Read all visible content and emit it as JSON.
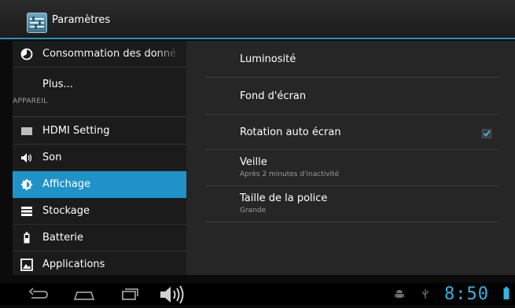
{
  "titlebar": {
    "title": "Paramètres"
  },
  "sidebar": {
    "items": [
      {
        "label": "Consommation des donné",
        "icon": "data-usage-icon"
      },
      {
        "label": "Plus..."
      },
      {
        "label": "HDMI Setting",
        "icon": "hdmi-icon"
      },
      {
        "label": "Son",
        "icon": "volume-icon"
      },
      {
        "label": "Affichage",
        "icon": "display-icon",
        "selected": true
      },
      {
        "label": "Stockage",
        "icon": "storage-icon"
      },
      {
        "label": "Batterie",
        "icon": "battery-icon"
      },
      {
        "label": "Applications",
        "icon": "applications-icon"
      }
    ],
    "section_header": "APPAREIL"
  },
  "display_settings": {
    "brightness": {
      "title": "Luminosité"
    },
    "wallpaper": {
      "title": "Fond d'écran"
    },
    "auto_rotate": {
      "title": "Rotation auto écran",
      "checked": true
    },
    "sleep": {
      "title": "Veille",
      "subtitle": "Après 2 minutes d'inactivité"
    },
    "font_size": {
      "title": "Taille de la police",
      "subtitle": "Grande"
    }
  },
  "status": {
    "time": "8:50"
  },
  "colors": {
    "accent": "#33b5e5",
    "selected": "#1f93c8"
  }
}
